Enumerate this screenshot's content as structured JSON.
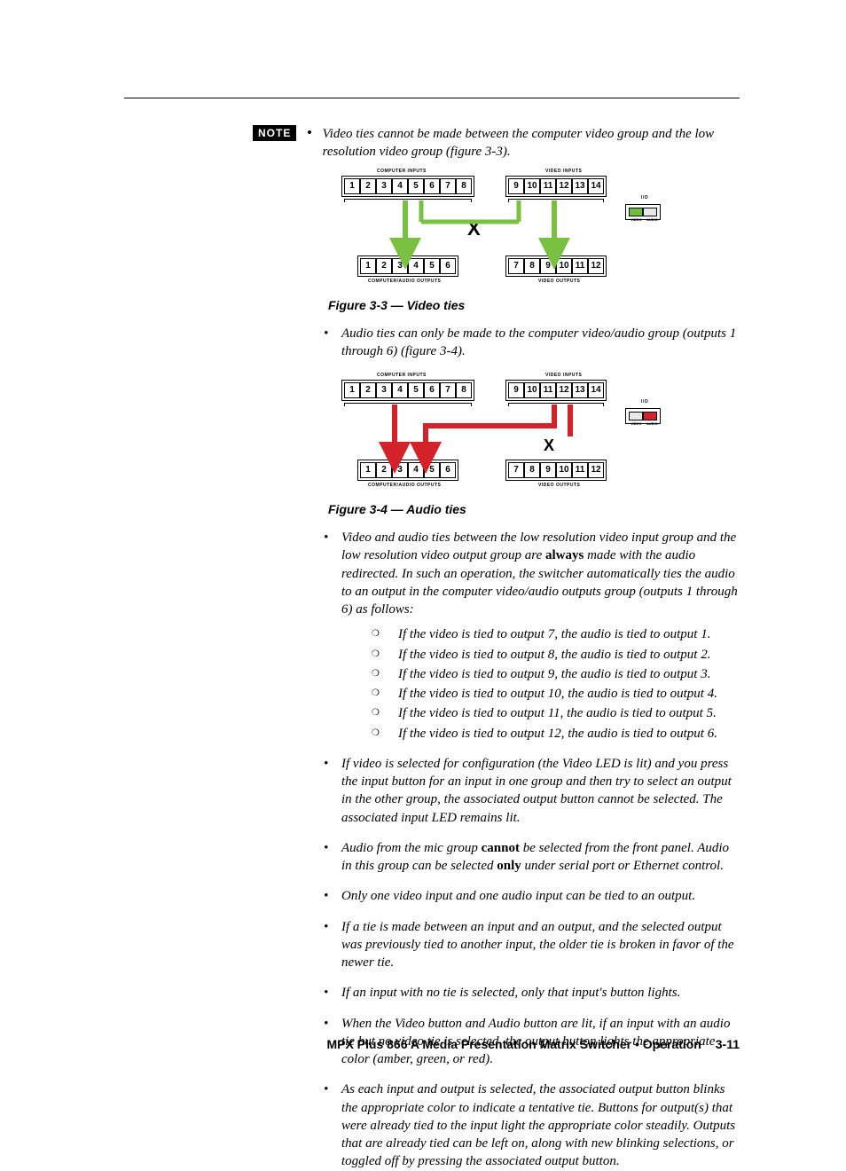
{
  "note_label": "NOTE",
  "bullets": {
    "b0": "Video ties cannot be made between the computer video group and the low resolution video group (figure 3-3).",
    "b1": "Audio ties can only be made to the computer video/audio group (outputs 1 through 6) (figure 3-4).",
    "b2_pre": "Video and audio ties between the low resolution video input group and the low resolution video output group are ",
    "b2_bold": "always",
    "b2_post": " made with the audio redirected. In such an operation, the switcher automatically ties the audio to an output in the computer video/audio outputs group (outputs 1 through 6) as follows:",
    "sub": [
      "If the video is tied to output 7, the audio is tied to output 1.",
      "If the video is tied to output 8, the audio is tied to output 2.",
      "If the video is tied to output 9, the audio is tied to output 3.",
      "If the video is tied to output 10, the audio is tied to output 4.",
      "If the video is tied to output 11, the audio is tied to output 5.",
      "If the video is tied to output 12, the audio is tied to output 6."
    ],
    "b3": "If video is selected for configuration (the Video LED is lit) and you press the input button for an input in one group and then try to select an output in the other group, the associated output button cannot be selected.  The associated input LED remains lit.",
    "b4_pre": "Audio from the mic group ",
    "b4_b1": "cannot",
    "b4_mid": " be selected from the front panel.  Audio in this group can be selected ",
    "b4_b2": "only",
    "b4_post": " under serial port or Ethernet control.",
    "b5": "Only one video input and one audio input can be tied to an output.",
    "b6": "If a tie is made between an input and an output, and the selected output was previously tied to another input, the older tie is broken in favor of the newer tie.",
    "b7": "If an input with no tie is selected, only that input's button lights.",
    "b8": "When the Video button and Audio button are lit, if an input with an audio tie but no video tie is selected, the output button lights the appropriate color (amber, green, or red).",
    "b9": "As each input and output is selected, the associated output button blinks the appropriate color to indicate a tentative tie.  Buttons for output(s) that were already tied to the input light the appropriate color steadily.  Outputs that are already tied can be left on, along with new blinking selections, or toggled off by pressing the associated output button."
  },
  "fig1_caption": "Figure 3-3 — Video ties",
  "fig2_caption": "Figure 3-4 — Audio ties",
  "labels": {
    "computer_inputs": "COMPUTER INPUTS",
    "video_inputs": "VIDEO INPUTS",
    "computer_audio_outputs": "COMPUTER/AUDIO OUTPUTS",
    "video_outputs": "VIDEO OUTPUTS",
    "io": "I/O",
    "video": "VIDEO",
    "audio": "AUDIO"
  },
  "inputs_left": [
    "1",
    "2",
    "3",
    "4",
    "5",
    "6",
    "7",
    "8"
  ],
  "inputs_right": [
    "9",
    "10",
    "11",
    "12",
    "13",
    "14"
  ],
  "outputs_left": [
    "1",
    "2",
    "3",
    "4",
    "5",
    "6"
  ],
  "outputs_right": [
    "7",
    "8",
    "9",
    "10",
    "11",
    "12"
  ],
  "footer_text": "MPX Plus 866 A Media Presentation Matrix Switcher • Operation",
  "footer_page": "3-11",
  "chart_data": [
    {
      "type": "diagram",
      "title": "Figure 3-3 — Video ties",
      "mode": "video",
      "input_groups": {
        "computer_inputs": [
          1,
          2,
          3,
          4,
          5,
          6,
          7,
          8
        ],
        "video_inputs": [
          9,
          10,
          11,
          12,
          13,
          14
        ]
      },
      "output_groups": {
        "computer_audio_outputs": [
          1,
          2,
          3,
          4,
          5,
          6
        ],
        "video_outputs": [
          7,
          8,
          9,
          10,
          11,
          12
        ]
      },
      "allowed_ties": [
        {
          "from_group": "computer_inputs",
          "to_group": "computer_audio_outputs"
        },
        {
          "from_group": "video_inputs",
          "to_group": "video_outputs"
        }
      ],
      "forbidden_cross_group": true
    },
    {
      "type": "diagram",
      "title": "Figure 3-4 — Audio ties",
      "mode": "audio",
      "input_groups": {
        "computer_inputs": [
          1,
          2,
          3,
          4,
          5,
          6,
          7,
          8
        ],
        "video_inputs": [
          9,
          10,
          11,
          12,
          13,
          14
        ]
      },
      "output_groups": {
        "computer_audio_outputs": [
          1,
          2,
          3,
          4,
          5,
          6
        ],
        "video_outputs": [
          7,
          8,
          9,
          10,
          11,
          12
        ]
      },
      "allowed_ties": [
        {
          "from_group": "computer_inputs",
          "to_group": "computer_audio_outputs"
        },
        {
          "from_group": "video_inputs",
          "to_group": "computer_audio_outputs"
        }
      ],
      "forbidden_target_group": "video_outputs"
    }
  ]
}
